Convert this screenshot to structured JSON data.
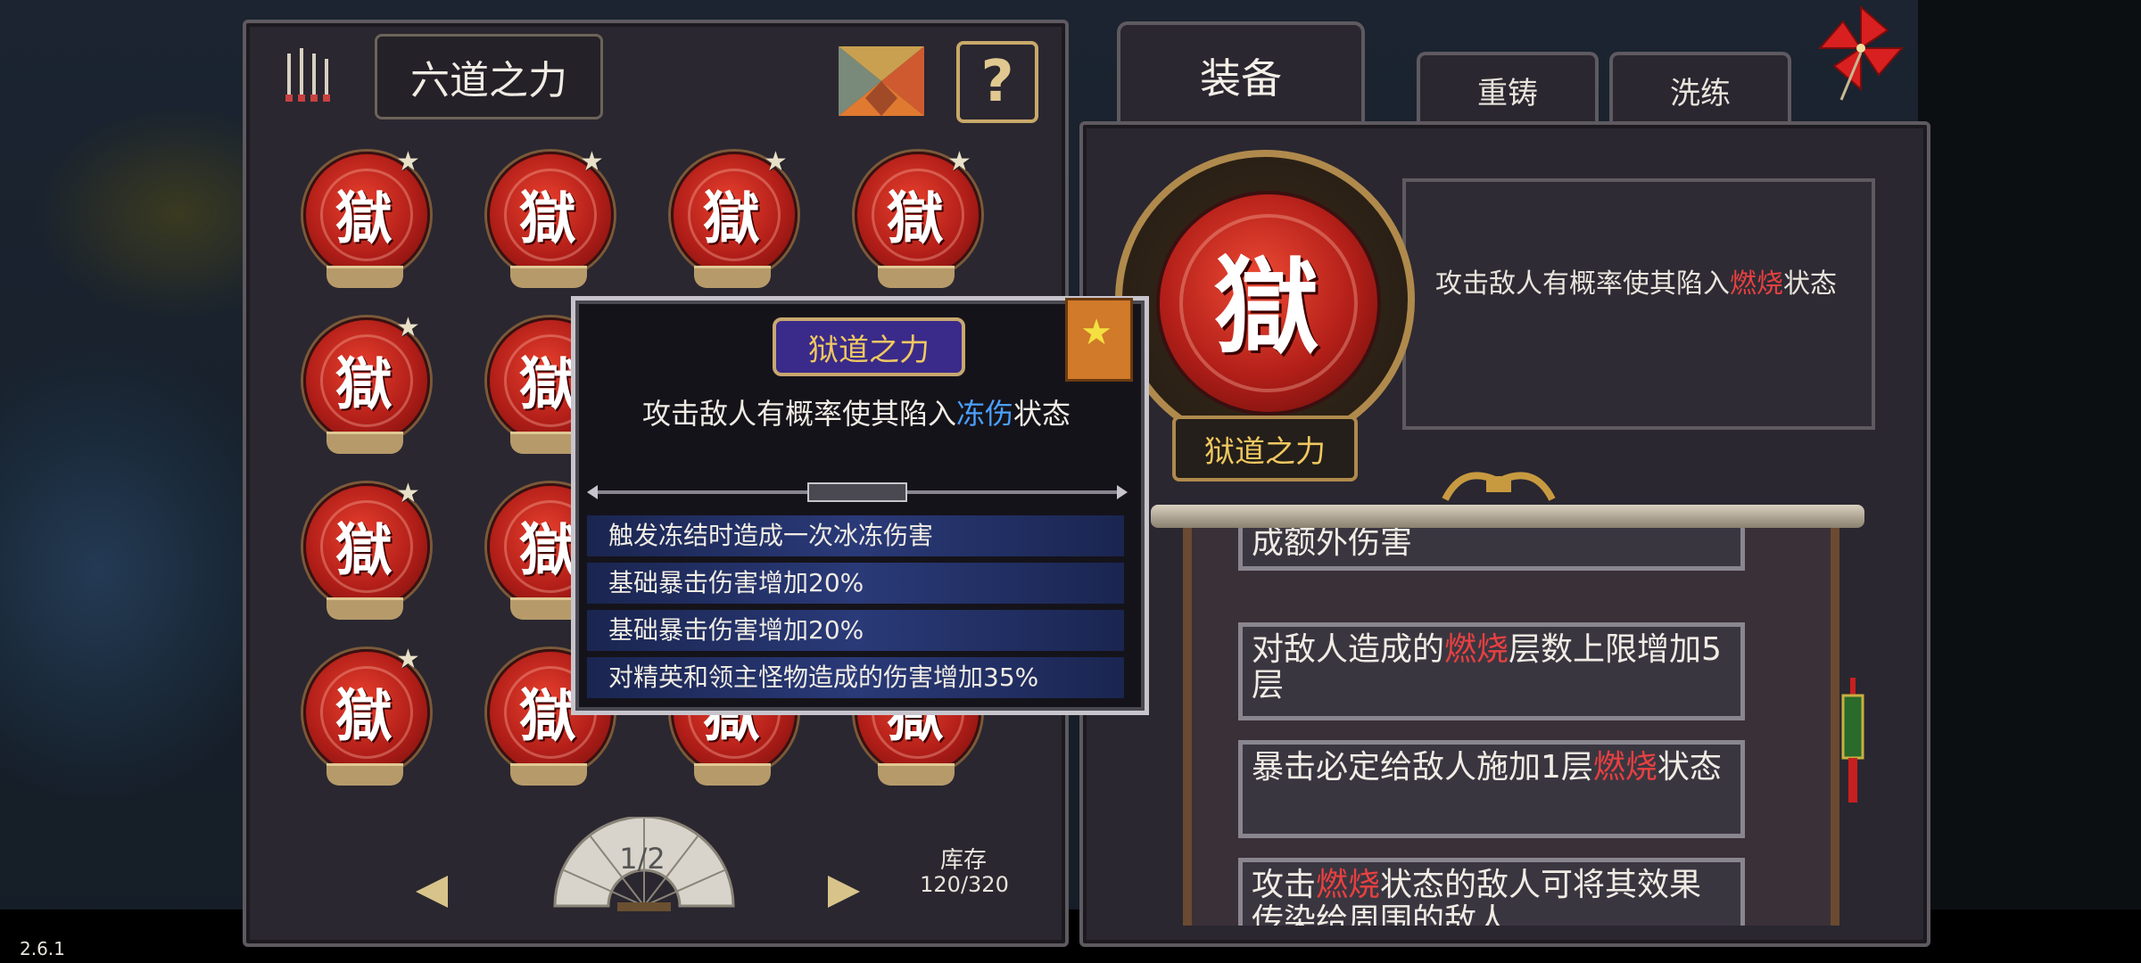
{
  "left_panel": {
    "title": "六道之力",
    "orb_glyph": "獄",
    "orb_star": "★",
    "pager": {
      "page": "1/2"
    },
    "stock": {
      "label": "库存",
      "value": "120/320"
    }
  },
  "tabs": {
    "equip": "装备",
    "recast": "重铸",
    "refine": "洗练"
  },
  "selected": {
    "glyph": "獄",
    "desc_before": "攻击敌人有概率使其陷入",
    "desc_keyword": "燃烧",
    "desc_after": "状态",
    "name": "狱道之力"
  },
  "scroll_cards": [
    {
      "before": "成额外伤害",
      "keyword": "",
      "after": ""
    },
    {
      "before": "对敌人造成的",
      "keyword": "燃烧",
      "after": "层数上限增加5层"
    },
    {
      "before": "暴击必定给敌人施加1层",
      "keyword": "燃烧",
      "after": "状态"
    },
    {
      "before": "攻击",
      "keyword": "燃烧",
      "after": "状态的敌人可将其效果传染给周围的敌人"
    }
  ],
  "tooltip": {
    "title": "狱道之力",
    "desc_before": "攻击敌人有概率使其陷入",
    "desc_keyword": "冻伤",
    "desc_after": "状态",
    "lines": [
      "触发冻结时造成一次冰冻伤害",
      "基础暴击伤害增加20%",
      "基础暴击伤害增加20%",
      "对精英和领主怪物造成的伤害增加35%"
    ]
  },
  "version": "2.6.1",
  "colors": {
    "fire": "#e84040",
    "ice": "#4aa0ff",
    "gold": "#f0c860",
    "orb_red": "#b11e18"
  },
  "icons": [
    "arrows-icon",
    "tangram-icon",
    "help-icon",
    "star-icon",
    "pinwheel-icon",
    "fan-icon",
    "tassel-icon"
  ]
}
